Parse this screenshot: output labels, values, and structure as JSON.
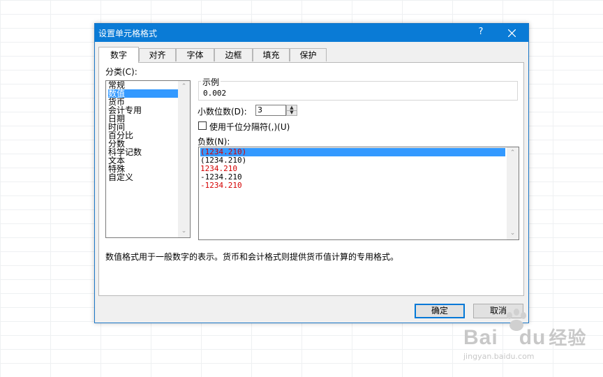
{
  "dialog": {
    "title": "设置单元格格式",
    "help": "?",
    "close": "✕"
  },
  "tabs": [
    {
      "label": "数字",
      "active": true
    },
    {
      "label": "对齐"
    },
    {
      "label": "字体"
    },
    {
      "label": "边框"
    },
    {
      "label": "填充"
    },
    {
      "label": "保护"
    }
  ],
  "category": {
    "label": "分类(C):",
    "items": [
      "常规",
      "数值",
      "货币",
      "会计专用",
      "日期",
      "时间",
      "百分比",
      "分数",
      "科学记数",
      "文本",
      "特殊",
      "自定义"
    ],
    "selected": "数值"
  },
  "sample": {
    "label": "示例",
    "value": "0.002"
  },
  "decimals": {
    "label": "小数位数(D):",
    "value": "3"
  },
  "thousands": {
    "label": "使用千位分隔符(,)(U)",
    "checked": false
  },
  "negative": {
    "label": "负数(N):",
    "items": [
      {
        "text": "(1234.210)",
        "color": "#d40000",
        "selected": true
      },
      {
        "text": "(1234.210)",
        "color": "#000000"
      },
      {
        "text": "1234.210",
        "color": "#d40000"
      },
      {
        "text": "-1234.210",
        "color": "#000000"
      },
      {
        "text": "-1234.210",
        "color": "#d40000"
      }
    ]
  },
  "description": "数值格式用于一般数字的表示。货币和会计格式则提供货币值计算的专用格式。",
  "buttons": {
    "ok": "确定",
    "cancel": "取消"
  },
  "watermark": {
    "brand": "Bai",
    "brand2": "du",
    "cn": "经验",
    "url": "jingyan.baidu.com"
  },
  "colors": {
    "titlebar": "#0a7bd6",
    "selection": "#3399ff",
    "negative_red": "#d40000"
  }
}
